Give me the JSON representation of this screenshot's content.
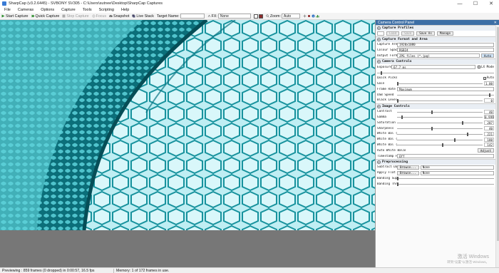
{
  "window": {
    "title": "SharpCap (v3.2.6445) - SVBONY SV305 - C:\\Users\\sutnee\\Desktop\\SharpCap Captures",
    "minimize": "—",
    "maximize": "☐",
    "close": "✕"
  },
  "menu": [
    "File",
    "Cameras",
    "Options",
    "Capture",
    "Tools",
    "Scripting",
    "Help"
  ],
  "toolbar": {
    "start_capture": "Start Capture",
    "quick_capture": "Quick Capture",
    "stop_capture": "Stop Capture",
    "focus": "Focus",
    "snapshot": "Snapshot",
    "live_stack": "Live Stack",
    "target_name_label": "Target Name:",
    "target_name_value": "",
    "fx_label": "FX:",
    "fx_value": "None",
    "zoom_label": "Zoom:",
    "zoom_value": "Auto"
  },
  "colors": {
    "panel_title": "#3c6ea5",
    "viewer_cell_wall": "#0e8591",
    "viewer_cell_fill": "#bff0f5"
  },
  "panel": {
    "title": "Camera Control Panel",
    "close": "✕",
    "capture_profiles": {
      "header": "Capture Profiles",
      "load": "Load",
      "save": "Save",
      "save_as": "Save As",
      "manage": "Manage"
    },
    "capture_format": {
      "header": "Capture Format and Area",
      "rows": [
        {
          "label": "Capture Area",
          "value": "1920x1080"
        },
        {
          "label": "Colour Space",
          "value": "RGB24"
        },
        {
          "label": "Output Format",
          "value": "JPG files (*.jpg)"
        }
      ],
      "auto_button": "Auto"
    },
    "camera_controls": {
      "header": "Camera Controls",
      "exposure_label": "Exposure",
      "exposure_value": "67.7 ms",
      "lx_mode": "LX Mode",
      "quick_picks": "Quick Picks",
      "auto": "Auto",
      "gain_label": "Gain",
      "gain_value": "1.00",
      "frame_rate_label": "Frame Rate Limit",
      "frame_rate_value": "Maximum",
      "usb_speed_label": "USB Speed",
      "black_level_label": "Black Level",
      "black_level_value": "0"
    },
    "image_controls": {
      "header": "Image Controls",
      "rows": [
        {
          "label": "Contrast",
          "value": "40",
          "level": 0.42
        },
        {
          "label": "Gamma",
          "value": "0.999",
          "level": 0.05
        },
        {
          "label": "Saturation",
          "value": "207",
          "level": 0.8
        },
        {
          "label": "Sharpness",
          "value": "40",
          "level": 0.42
        },
        {
          "label": "White Bal (B)",
          "value": "221",
          "level": 0.86
        },
        {
          "label": "White Bal (G)",
          "value": "180",
          "level": 0.7
        },
        {
          "label": "White Bal (R)",
          "value": "142",
          "level": 0.55
        }
      ],
      "auto_white_balance": "Auto White Balance",
      "adjust": "Adjust",
      "timestamp_label": "Timestamp Frames",
      "timestamp_value": "Off"
    },
    "preprocessing": {
      "header": "Preprocessing",
      "subtract_dark_label": "Subtract Dark",
      "apply_flat_label": "Apply Flat",
      "browse": "Browse...",
      "none": "None",
      "banding_label": "Banding Suppression",
      "banding_threshold_label": "Banding Threshold"
    }
  },
  "watermark": {
    "line1": "激活 Windows",
    "line2": "转到\"设置\"以激活 Windows。"
  },
  "status": {
    "left": "Previewing : 859 frames (0 dropped) in 0:00:57, 16.5 fps",
    "right": "Memory: 1 of 172 frames in use."
  }
}
